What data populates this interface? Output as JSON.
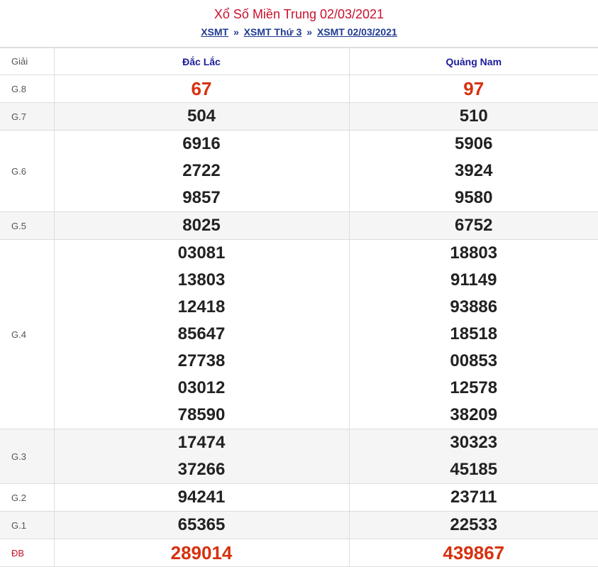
{
  "title": "Xổ Số Miền Trung 02/03/2021",
  "breadcrumb": {
    "link1": "XSMT",
    "sep1": "»",
    "link2": "XSMT Thứ 3",
    "sep2": "»",
    "link3": "XSMT 02/03/2021"
  },
  "table": {
    "label_header": "Giải",
    "provinces": [
      "Đắc Lắc",
      "Quảng Nam"
    ],
    "rows": [
      {
        "label": "G.8",
        "col1": [
          "67"
        ],
        "col2": [
          "97"
        ]
      },
      {
        "label": "G.7",
        "col1": [
          "504"
        ],
        "col2": [
          "510"
        ]
      },
      {
        "label": "G.6",
        "col1": [
          "6916",
          "2722",
          "9857"
        ],
        "col2": [
          "5906",
          "3924",
          "9580"
        ]
      },
      {
        "label": "G.5",
        "col1": [
          "8025"
        ],
        "col2": [
          "6752"
        ]
      },
      {
        "label": "G.4",
        "col1": [
          "03081",
          "13803",
          "12418",
          "85647",
          "27738",
          "03012",
          "78590"
        ],
        "col2": [
          "18803",
          "91149",
          "93886",
          "18518",
          "00853",
          "12578",
          "38209"
        ]
      },
      {
        "label": "G.3",
        "col1": [
          "17474",
          "37266"
        ],
        "col2": [
          "30323",
          "45185"
        ]
      },
      {
        "label": "G.2",
        "col1": [
          "94241"
        ],
        "col2": [
          "23711"
        ]
      },
      {
        "label": "G.1",
        "col1": [
          "65365"
        ],
        "col2": [
          "22533"
        ]
      },
      {
        "label": "ĐB",
        "col1": [
          "289014"
        ],
        "col2": [
          "439867"
        ]
      }
    ]
  },
  "colors": {
    "title": "#c8102e",
    "link": "#1f3a93",
    "province": "#1b1b9a",
    "highlight_number": "#d6310f",
    "number": "#222222"
  }
}
